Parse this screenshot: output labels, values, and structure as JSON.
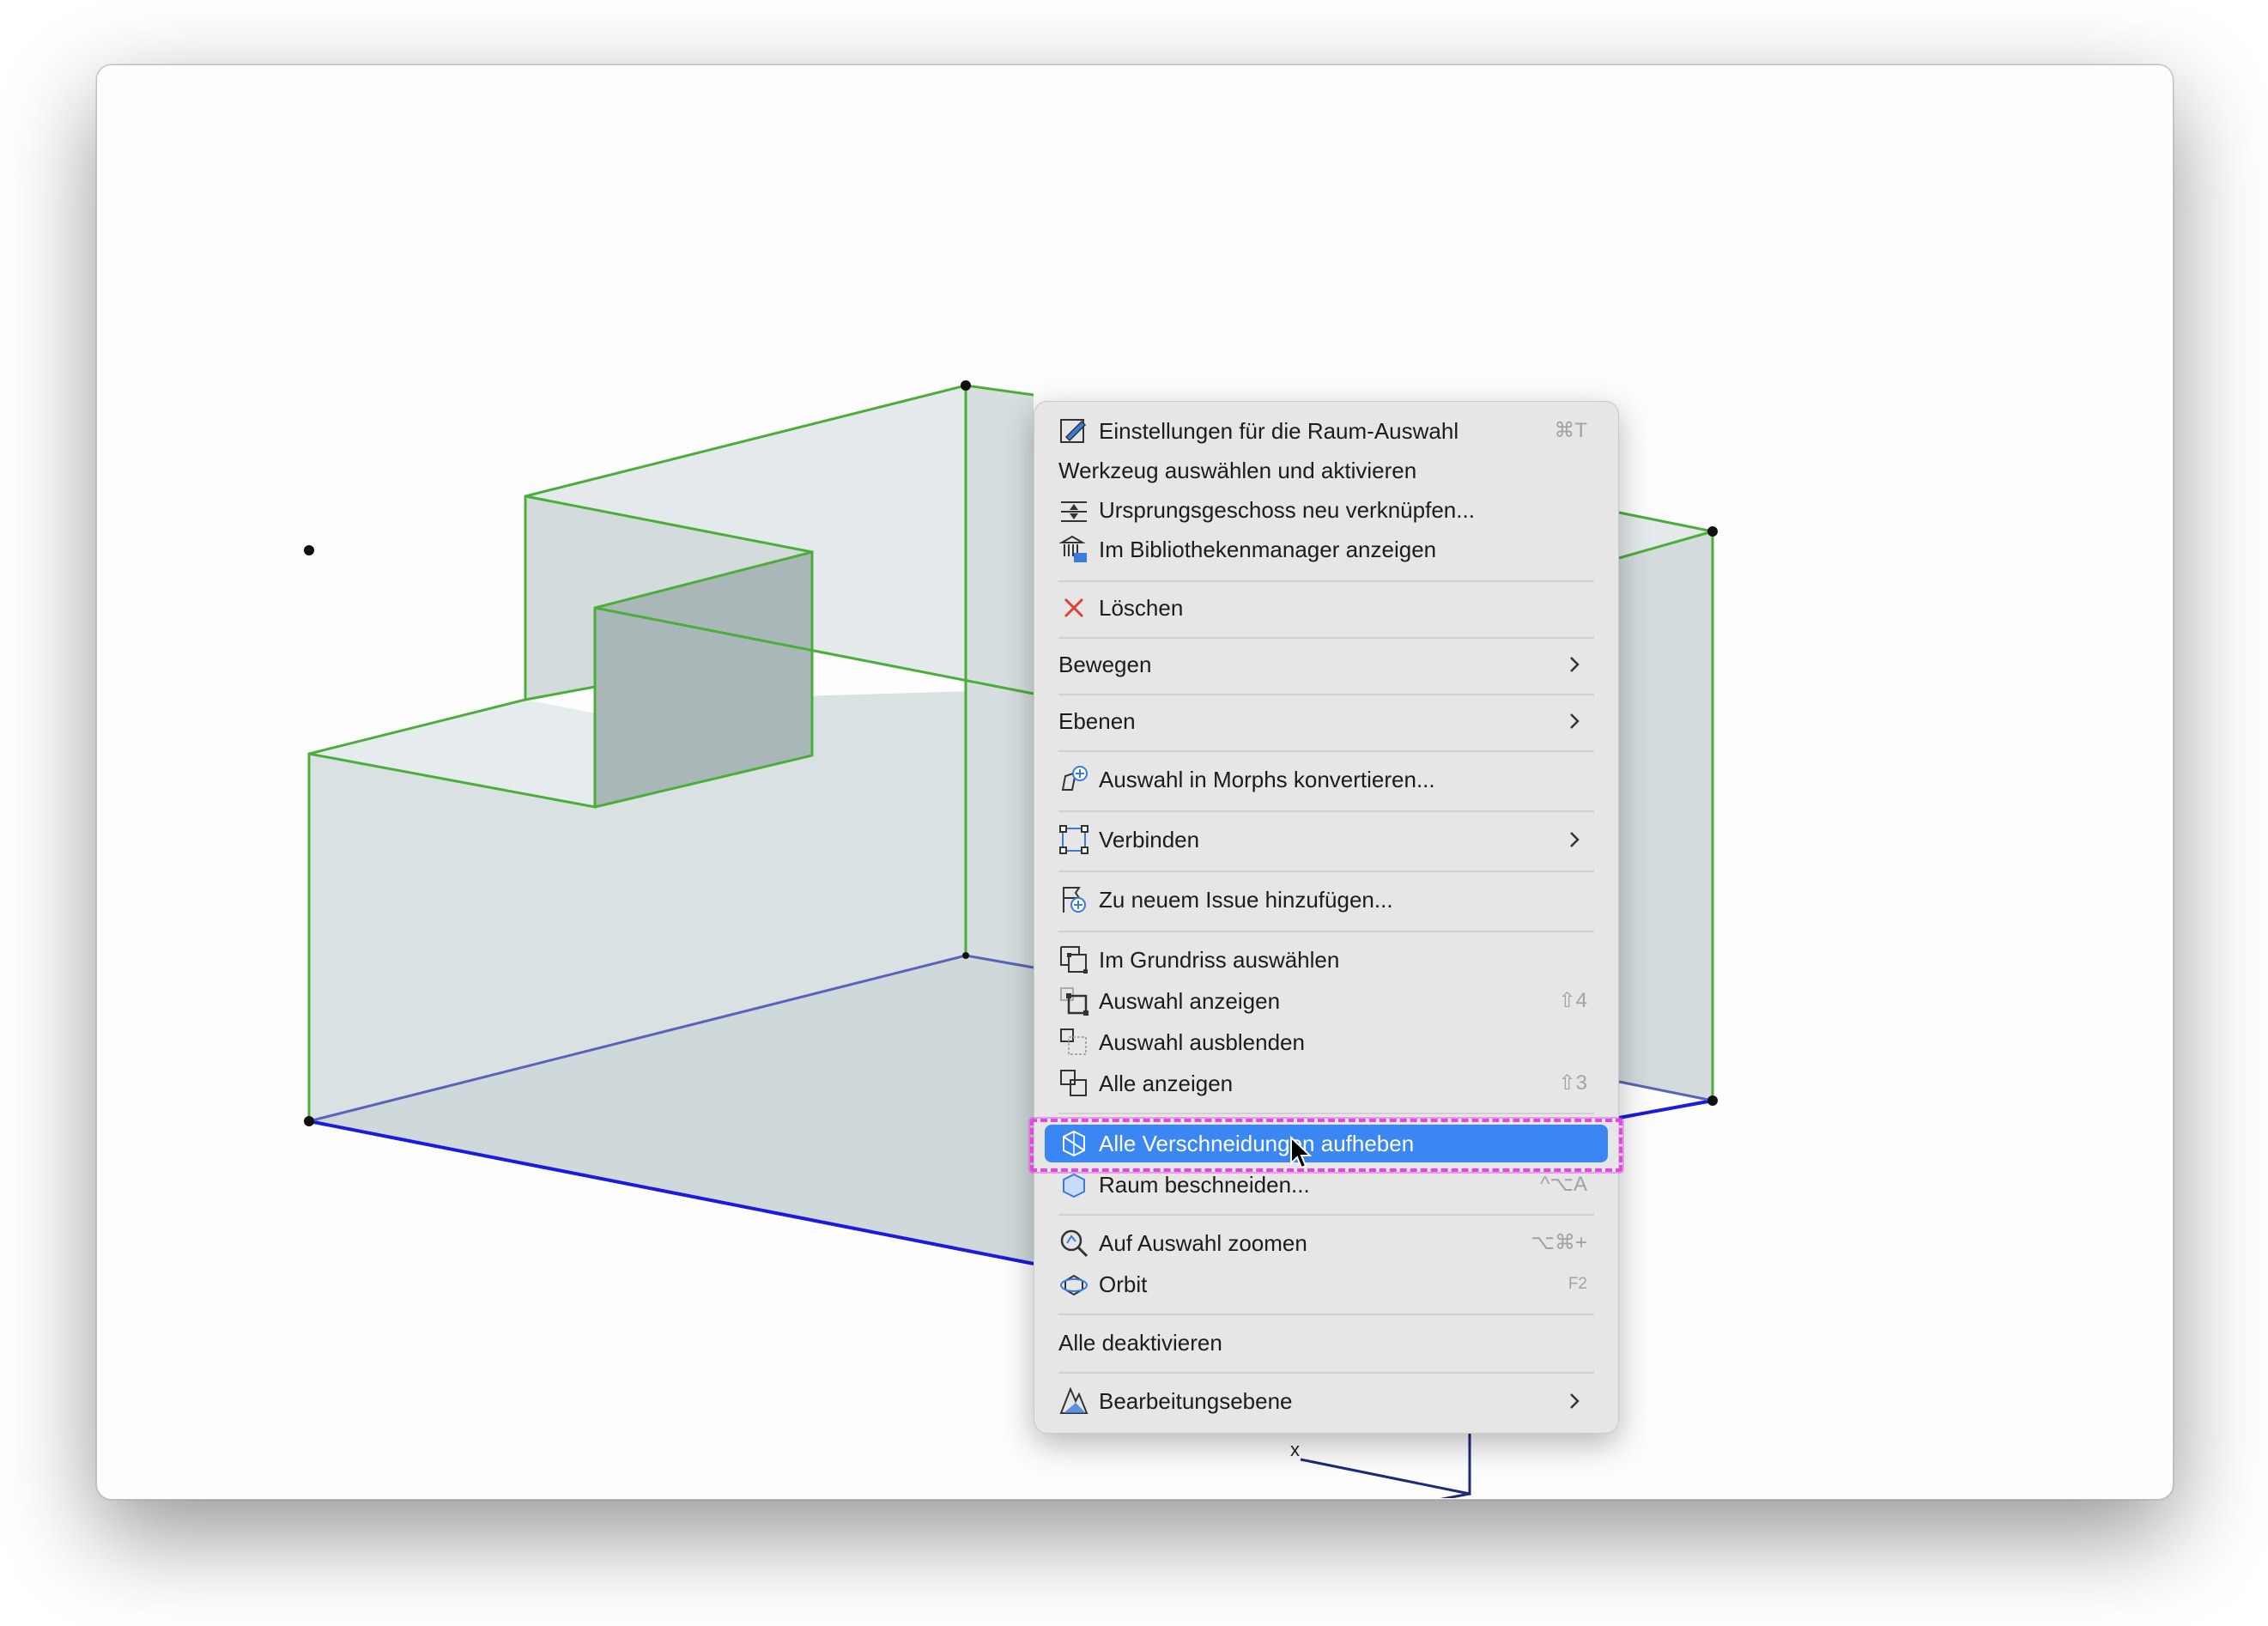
{
  "menu": {
    "items": [
      {
        "label": "Einstellungen für die Raum-Auswahl",
        "shortcut": "⌘T",
        "icon": "settings-pencil-icon"
      },
      {
        "label": "Werkzeug auswählen und aktivieren"
      },
      {
        "label": "Ursprungsgeschoss neu verknüpfen...",
        "icon": "story-link-icon"
      },
      {
        "label": "Im Bibliothekenmanager anzeigen",
        "icon": "library-icon"
      },
      {
        "label": "Löschen",
        "icon": "delete-x-icon"
      },
      {
        "label": "Bewegen",
        "submenu": true
      },
      {
        "label": "Ebenen",
        "submenu": true
      },
      {
        "label": "Auswahl in Morphs konvertieren...",
        "icon": "morph-icon"
      },
      {
        "label": "Verbinden",
        "submenu": true,
        "icon": "connect-icon"
      },
      {
        "label": "Zu neuem Issue hinzufügen...",
        "icon": "issue-add-icon"
      },
      {
        "label": "Im Grundriss auswählen",
        "icon": "floorplan-select-icon"
      },
      {
        "label": "Auswahl anzeigen",
        "shortcut": "⇧4",
        "icon": "show-selection-icon"
      },
      {
        "label": "Auswahl ausblenden",
        "icon": "hide-selection-icon"
      },
      {
        "label": "Alle anzeigen",
        "shortcut": "⇧3",
        "icon": "show-all-icon"
      },
      {
        "label": "Alle Verschneidungen aufheben",
        "highlighted": true,
        "icon": "intersection-icon"
      },
      {
        "label": "Raum beschneiden...",
        "shortcut": "^⌥A",
        "icon": "trim-space-icon"
      },
      {
        "label": "Auf Auswahl zoomen",
        "shortcut": "⌥⌘+",
        "icon": "zoom-selection-icon"
      },
      {
        "label": "Orbit",
        "shortcut": "F2",
        "icon": "orbit-icon"
      },
      {
        "label": "Alle deaktivieren"
      },
      {
        "label": "Bearbeitungsebene",
        "submenu": true,
        "icon": "editing-plane-icon"
      }
    ]
  },
  "viewport": {
    "axis_label": "x"
  },
  "colors": {
    "highlight": "#3a86f2",
    "focus_outline": "#e545e0",
    "edge_green": "#4cae3a",
    "edge_blue": "#1a1ae0"
  }
}
